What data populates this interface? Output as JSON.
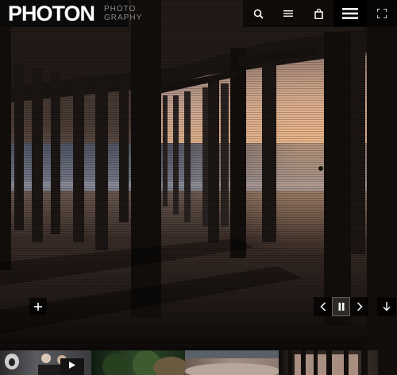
{
  "header": {
    "logo_word": "PHOTON",
    "logo_sub_line1": "PHOTO",
    "logo_sub_line2": "GRAPHY",
    "icons": [
      "search-icon",
      "list-icon",
      "shopping-bag-icon",
      "menu-icon",
      "fullscreen-icon"
    ]
  },
  "controls": {
    "add_icon": "plus-icon",
    "prev_icon": "chevron-left-icon",
    "pause_icon": "pause-icon",
    "next_icon": "chevron-right-icon",
    "scroll_icon": "arrow-down-icon"
  },
  "thumbnails": [
    {
      "name": "thumb-people",
      "has_play": true
    },
    {
      "name": "thumb-forest",
      "has_play": false
    },
    {
      "name": "thumb-sand",
      "has_play": false
    },
    {
      "name": "thumb-pier",
      "has_play": false
    }
  ],
  "colors": {
    "header_bg": "#0b0b0b",
    "control_bg": "#000000",
    "logo_text": "#ffffff",
    "logo_sub_text": "#8a8a8a"
  }
}
